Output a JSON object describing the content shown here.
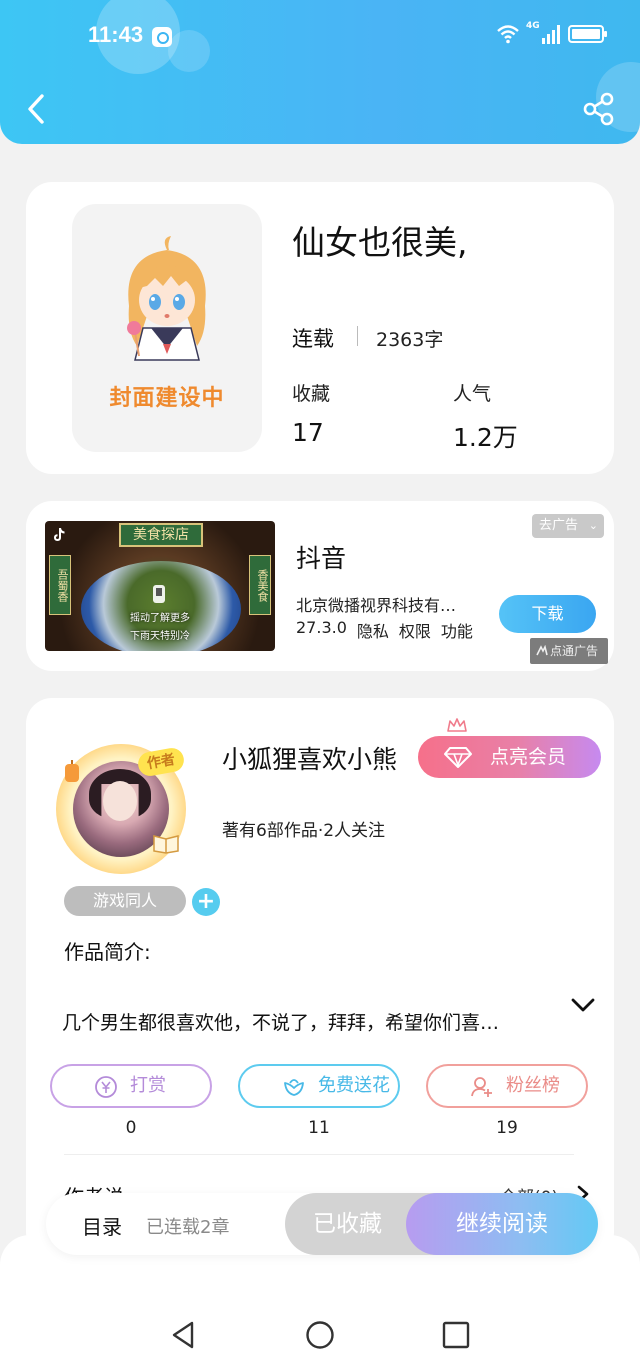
{
  "status_bar": {
    "time": "11:43",
    "network": "4G"
  },
  "header": {
    "back_icon": "chevron-left-icon",
    "share_icon": "share-icon",
    "color": "#3dc6f4"
  },
  "book": {
    "cover_text": "封面建设中",
    "title": "仙女也很美,",
    "status": "连载",
    "word_count": "2363字",
    "stats": [
      {
        "label": "收藏",
        "value": "17"
      },
      {
        "label": "人气",
        "value": "1.2万"
      }
    ]
  },
  "ad": {
    "remove_label": "去广告",
    "image_sign": "美食探店",
    "image_side_left": "吾蜀香",
    "image_side_right": "香美食",
    "image_caption1": "摇动了解更多",
    "image_caption2": "下雨天特别冷",
    "title": "抖音",
    "company": "北京微播视界科技有…",
    "version": "27.3.0",
    "links": [
      "隐私",
      "权限",
      "功能"
    ],
    "download_label": "下载",
    "badge": "点通广告"
  },
  "author": {
    "badge": "作者",
    "name": "小狐狸喜欢小熊",
    "vip_label": "点亮会员",
    "meta": "著有6部作品·2人关注",
    "genre_tag": "游戏同人",
    "add_tag": "+",
    "intro_label": "作品简介:",
    "intro_text": "几个男生都很喜欢他，不说了，拜拜，希望你们喜…",
    "actions": [
      {
        "label": "打赏",
        "count": "0",
        "icon": "yuan-coin-icon"
      },
      {
        "label": "免费送花",
        "count": "11",
        "icon": "flower-icon"
      },
      {
        "label": "粉丝榜",
        "count": "19",
        "icon": "user-fans-icon"
      }
    ],
    "author_says_label": "作者说",
    "all_label": "全部(0)"
  },
  "bottom_bar": {
    "toc_label": "目录",
    "chapters": "已连载2章",
    "collected_label": "已收藏",
    "continue_label": "继续阅读"
  },
  "system_nav": {
    "back": "triangle-back-icon",
    "home": "circle-home-icon",
    "recent": "square-recent-icon"
  }
}
